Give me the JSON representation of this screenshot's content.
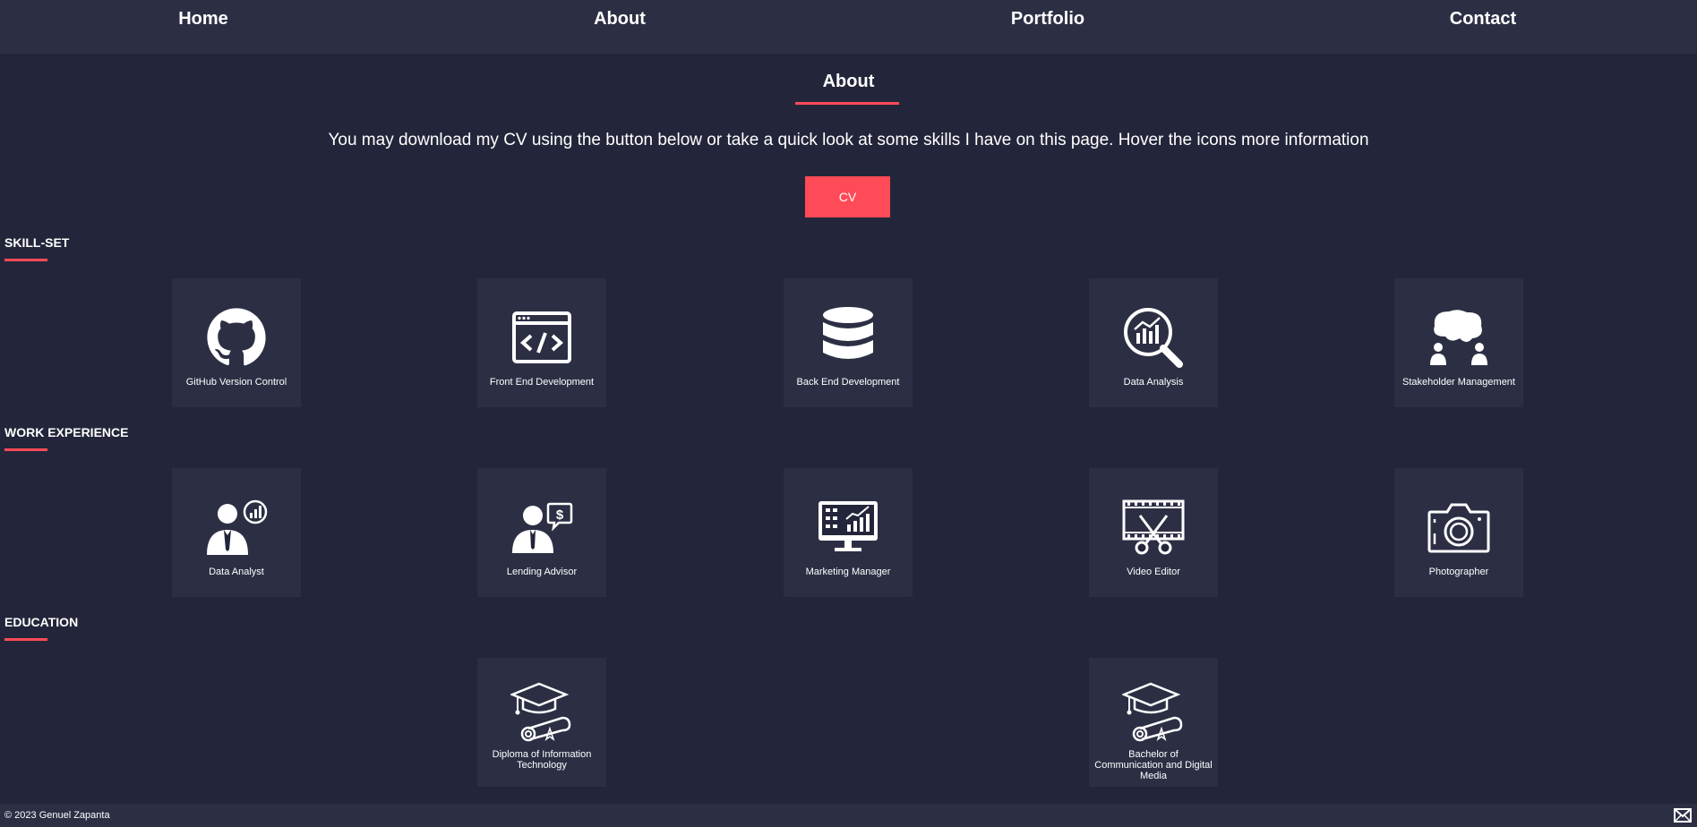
{
  "nav": {
    "home": "Home",
    "about": "About",
    "portfolio": "Portfolio",
    "contact": "Contact"
  },
  "page": {
    "title": "About",
    "intro": "You may download my CV using the button below or take a quick look at some skills I have on this page. Hover the icons more information",
    "cv_label": "CV"
  },
  "accent_color": "#ff4a57",
  "sections": {
    "skills": {
      "heading": "SKILL-SET",
      "items": [
        {
          "label": "GitHub Version Control",
          "icon": "github-icon"
        },
        {
          "label": "Front End Development",
          "icon": "code-window-icon"
        },
        {
          "label": "Back End Development",
          "icon": "database-icon"
        },
        {
          "label": "Data Analysis",
          "icon": "analytics-magnifier-icon"
        },
        {
          "label": "Stakeholder Management",
          "icon": "people-speech-icon"
        }
      ]
    },
    "work": {
      "heading": "WORK EXPERIENCE",
      "items": [
        {
          "label": "Data Analyst",
          "icon": "analyst-person-icon"
        },
        {
          "label": "Lending Advisor",
          "icon": "advisor-dollar-icon"
        },
        {
          "label": "Marketing Manager",
          "icon": "monitor-marketing-icon"
        },
        {
          "label": "Video Editor",
          "icon": "film-scissors-icon"
        },
        {
          "label": "Photographer",
          "icon": "camera-icon"
        }
      ]
    },
    "education": {
      "heading": "EDUCATION",
      "items": [
        {
          "label": "Diploma of Information Technology",
          "icon": "graduation-diploma-icon"
        },
        {
          "label": "Bachelor of Communication and Digital Media",
          "icon": "graduation-diploma-icon"
        }
      ]
    }
  },
  "footer": {
    "copyright": "© 2023 Genuel Zapanta",
    "mail_icon": "mail-icon"
  }
}
